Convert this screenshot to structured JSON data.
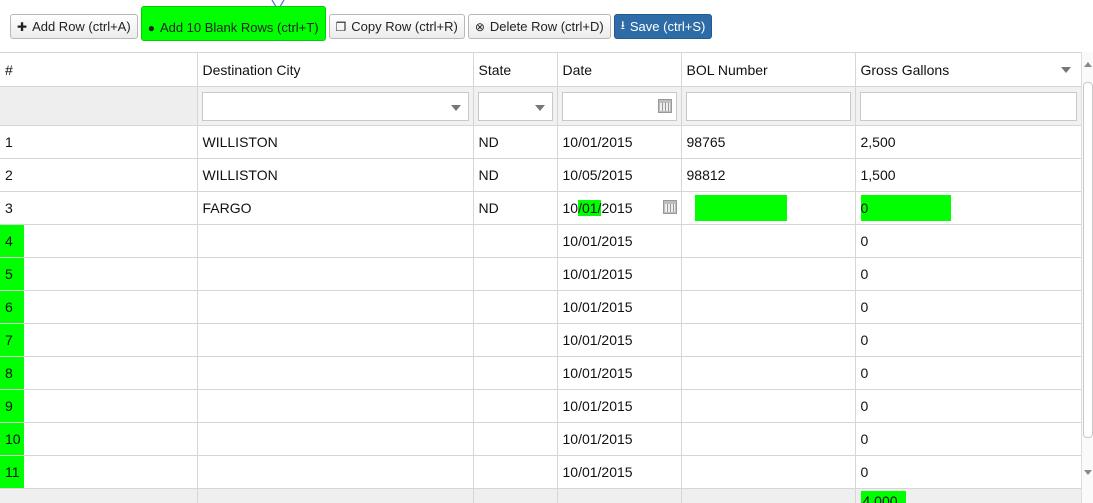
{
  "toolbar": {
    "add_row": "Add Row (ctrl+A)",
    "add_10": "Add 10 Blank Rows (ctrl+T)",
    "copy_row": "Copy Row (ctrl+R)",
    "delete_row": "Delete Row (ctrl+D)",
    "save": "Save (ctrl+S)"
  },
  "columns": [
    "#",
    "Destination City",
    "State",
    "Date",
    "BOL Number",
    "Gross Gallons"
  ],
  "rows": [
    {
      "num": "1",
      "city": "WILLISTON",
      "state": "ND",
      "date": "10/01/2015",
      "bol": "98765",
      "gallons": "2,500"
    },
    {
      "num": "2",
      "city": "WILLISTON",
      "state": "ND",
      "date": "10/05/2015",
      "bol": "98812",
      "gallons": "1,500"
    },
    {
      "num": "3",
      "city": "FARGO",
      "state": "ND",
      "date_a": "10",
      "date_b": "/01/",
      "date_c": "2015",
      "bol": "",
      "gallons": "0"
    },
    {
      "num": "4",
      "city": "",
      "state": "",
      "date": "10/01/2015",
      "bol": "",
      "gallons": "0"
    },
    {
      "num": "5",
      "city": "",
      "state": "",
      "date": "10/01/2015",
      "bol": "",
      "gallons": "0"
    },
    {
      "num": "6",
      "city": "",
      "state": "",
      "date": "10/01/2015",
      "bol": "",
      "gallons": "0"
    },
    {
      "num": "7",
      "city": "",
      "state": "",
      "date": "10/01/2015",
      "bol": "",
      "gallons": "0"
    },
    {
      "num": "8",
      "city": "",
      "state": "",
      "date": "10/01/2015",
      "bol": "",
      "gallons": "0"
    },
    {
      "num": "9",
      "city": "",
      "state": "",
      "date": "10/01/2015",
      "bol": "",
      "gallons": "0"
    },
    {
      "num": "10",
      "city": "",
      "state": "",
      "date": "10/01/2015",
      "bol": "",
      "gallons": "0"
    },
    {
      "num": "11",
      "city": "",
      "state": "",
      "date": "10/01/2015",
      "bol": "",
      "gallons": "0"
    }
  ],
  "footer": {
    "total_gallons": "4,000"
  },
  "colors": {
    "highlight": "#00ff00",
    "primary": "#2e6ca8"
  }
}
